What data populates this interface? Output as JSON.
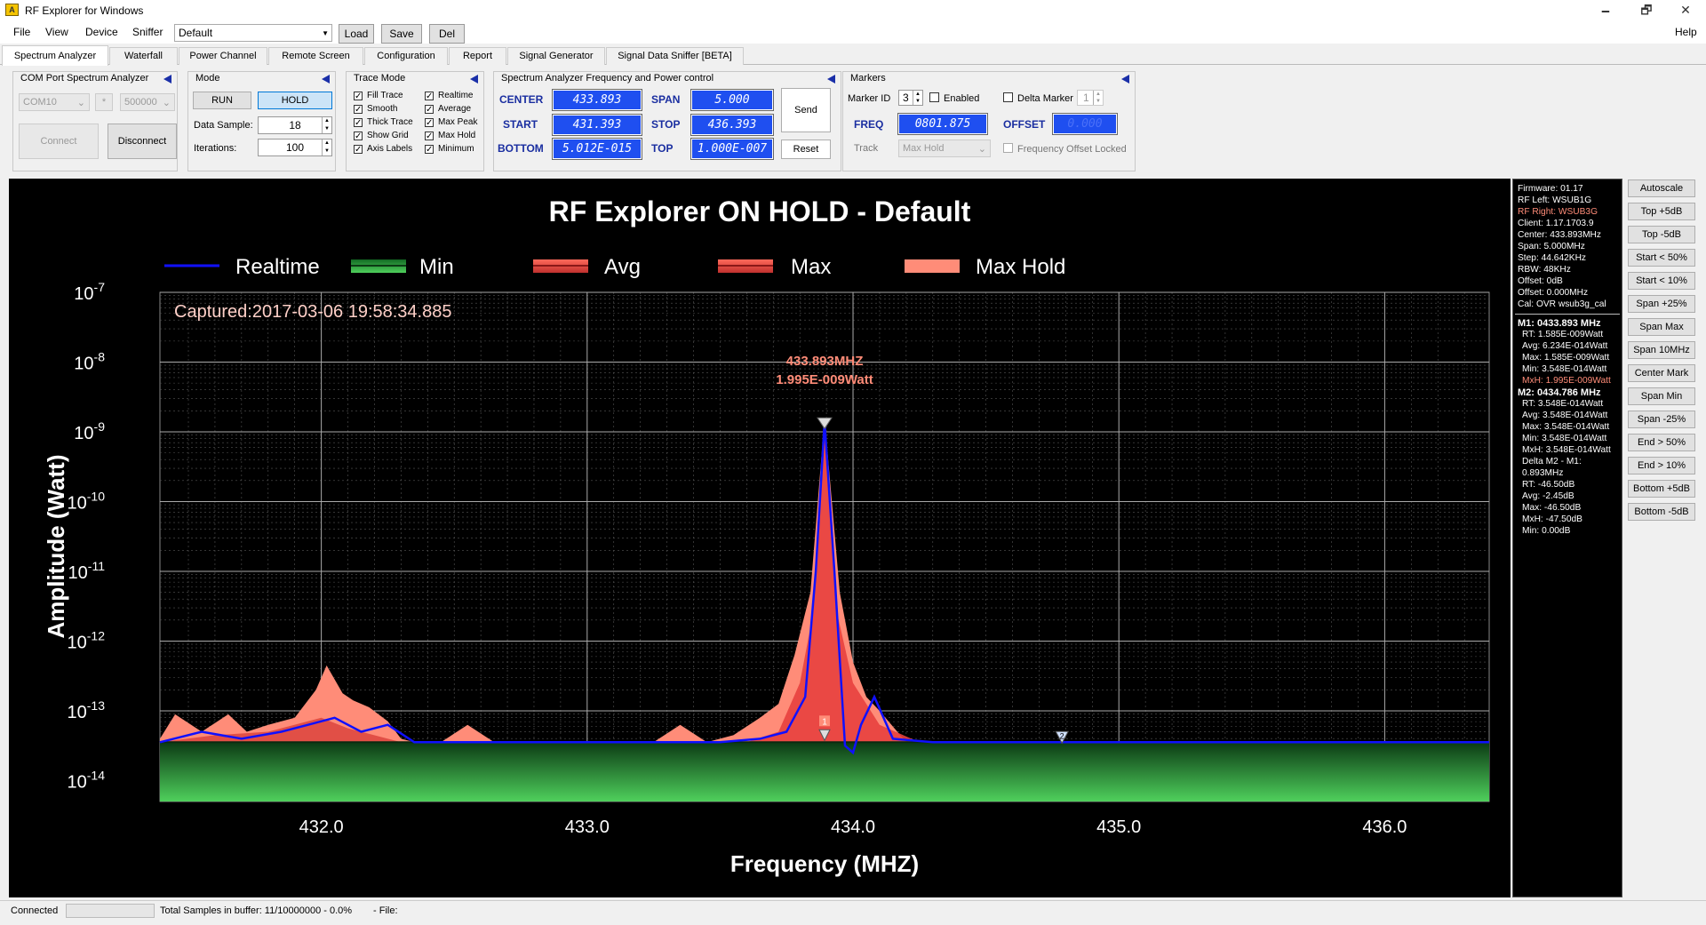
{
  "window": {
    "title": "RF Explorer for Windows",
    "minimize": "🗕",
    "restore": "🗗",
    "close": "✕",
    "logo": "A"
  },
  "menu": {
    "items": [
      "File",
      "View",
      "Device",
      "Sniffer"
    ],
    "help": "Help"
  },
  "toolbar": {
    "profile": "Default",
    "load": "Load",
    "save": "Save",
    "del": "Del"
  },
  "tabs": [
    "Spectrum Analyzer",
    "Waterfall",
    "Power Channel",
    "Remote Screen",
    "Configuration",
    "Report",
    "Signal Generator",
    "Signal Data Sniffer [BETA]"
  ],
  "com": {
    "title": "COM Port Spectrum Analyzer",
    "port": "COM10",
    "star": "*",
    "baud": "500000",
    "connect": "Connect",
    "disconnect": "Disconnect"
  },
  "mode": {
    "title": "Mode",
    "run": "RUN",
    "hold": "HOLD",
    "data_sample_label": "Data Sample:",
    "data_sample": "18",
    "iterations_label": "Iterations:",
    "iterations": "100"
  },
  "trace": {
    "title": "Trace Mode",
    "options": [
      {
        "label": "Fill Trace",
        "checked": true
      },
      {
        "label": "Smooth",
        "checked": true
      },
      {
        "label": "Thick Trace",
        "checked": true
      },
      {
        "label": "Show Grid",
        "checked": true
      },
      {
        "label": "Axis Labels",
        "checked": true
      },
      {
        "label": "Realtime",
        "checked": true
      },
      {
        "label": "Average",
        "checked": true
      },
      {
        "label": "Max Peak",
        "checked": true
      },
      {
        "label": "Max Hold",
        "checked": true
      },
      {
        "label": "Minimum",
        "checked": true
      }
    ]
  },
  "freqctl": {
    "title": "Spectrum Analyzer Frequency and Power control",
    "center_label": "CENTER",
    "center": "433.893",
    "span_label": "SPAN",
    "span": "5.000",
    "start_label": "START",
    "start": "431.393",
    "stop_label": "STOP",
    "stop": "436.393",
    "bottom_label": "BOTTOM",
    "bottom": "5.012E-015",
    "top_label": "TOP",
    "top": "1.000E-007",
    "send": "Send",
    "reset": "Reset"
  },
  "markers": {
    "title": "Markers",
    "id_label": "Marker ID",
    "id": "3",
    "enabled": "Enabled",
    "delta": "Delta Marker",
    "delta_val": "1",
    "freq_label": "FREQ",
    "freq": "0801.875",
    "offset_label": "OFFSET",
    "offset": "0.000",
    "track_label": "Track",
    "track": "Max Hold",
    "offset_locked": "Frequency Offset Locked"
  },
  "chart_data": {
    "type": "line",
    "title": "RF Explorer ON HOLD - Default",
    "xlabel": "Frequency (MHZ)",
    "ylabel": "Amplitude (Watt)",
    "xlim": [
      431.393,
      436.393
    ],
    "ylim_log10": [
      -14.3,
      -7
    ],
    "x_ticks": [
      "432.0",
      "433.0",
      "434.0",
      "435.0",
      "436.0"
    ],
    "y_ticks": [
      {
        "base": "10",
        "exp": "-7"
      },
      {
        "base": "10",
        "exp": "-8"
      },
      {
        "base": "10",
        "exp": "-9"
      },
      {
        "base": "10",
        "exp": "-10"
      },
      {
        "base": "10",
        "exp": "-11"
      },
      {
        "base": "10",
        "exp": "-12"
      },
      {
        "base": "10",
        "exp": "-13"
      },
      {
        "base": "10",
        "exp": "-14"
      }
    ],
    "captured": "Captured:2017-03-06 19:58:34.885",
    "grid": true,
    "legend": [
      {
        "name": "Realtime",
        "color": "#1010ff"
      },
      {
        "name": "Min",
        "color": "#2e9e3e"
      },
      {
        "name": "Avg",
        "color": "#e8403e"
      },
      {
        "name": "Max",
        "color": "#ee4545"
      },
      {
        "name": "Max Hold",
        "color": "#ff8c78"
      }
    ],
    "peak_annotation": {
      "freq": "433.893MHZ",
      "power": "1.995E-009Watt"
    },
    "marker_labels": [
      {
        "id": "1",
        "x": 433.893
      },
      {
        "id": "2",
        "x": 434.786
      }
    ],
    "series": [
      {
        "name": "Max Hold",
        "x": [
          431.393,
          431.45,
          431.55,
          431.65,
          431.72,
          431.8,
          431.9,
          431.98,
          432.02,
          432.08,
          432.12,
          432.18,
          432.25,
          432.3,
          432.35,
          432.45,
          432.55,
          432.65,
          432.75,
          432.85,
          432.95,
          433.05,
          433.15,
          433.25,
          433.35,
          433.45,
          433.55,
          433.65,
          433.72,
          433.78,
          433.84,
          433.893,
          433.95,
          434.0,
          434.05,
          434.1,
          434.2,
          434.3,
          434.4,
          434.5,
          434.6,
          434.7,
          434.8,
          434.9,
          435.0,
          435.5,
          436.0,
          436.393
        ],
        "y_log10": [
          -13.4,
          -13.05,
          -13.3,
          -13.05,
          -13.3,
          -13.2,
          -13.1,
          -12.7,
          -12.35,
          -12.75,
          -12.85,
          -12.95,
          -13.15,
          -13.4,
          -13.45,
          -13.45,
          -13.2,
          -13.45,
          -13.45,
          -13.45,
          -13.45,
          -13.45,
          -13.45,
          -13.45,
          -13.2,
          -13.45,
          -13.35,
          -13.1,
          -12.9,
          -12.2,
          -11.3,
          -8.8,
          -11.3,
          -12.3,
          -12.8,
          -13.0,
          -13.45,
          -13.45,
          -13.45,
          -13.45,
          -13.45,
          -13.45,
          -13.45,
          -13.45,
          -13.45,
          -13.45,
          -13.45,
          -13.45
        ]
      },
      {
        "name": "Realtime",
        "x": [
          431.393,
          431.55,
          431.7,
          431.85,
          431.95,
          432.05,
          432.15,
          432.25,
          432.35,
          432.6,
          433.0,
          433.5,
          433.65,
          433.75,
          433.82,
          433.86,
          433.893,
          433.93,
          433.97,
          434.0,
          434.03,
          434.08,
          434.15,
          434.3,
          434.786,
          435.5,
          436.393
        ],
        "y_log10": [
          -13.45,
          -13.3,
          -13.4,
          -13.3,
          -13.2,
          -13.1,
          -13.3,
          -13.2,
          -13.45,
          -13.45,
          -13.45,
          -13.45,
          -13.4,
          -13.3,
          -12.8,
          -11.0,
          -8.85,
          -11.0,
          -13.5,
          -13.6,
          -13.2,
          -12.8,
          -13.4,
          -13.45,
          -13.45,
          -13.45,
          -13.45
        ]
      },
      {
        "name": "Min",
        "x": [
          431.393,
          436.393
        ],
        "y_log10": [
          -13.45,
          -13.45
        ]
      }
    ]
  },
  "info": {
    "lines": [
      {
        "t": "Firmware: 01.17",
        "c": "#fff"
      },
      {
        "t": "RF Left: WSUB1G",
        "c": "#fff"
      },
      {
        "t": "RF Right: WSUB3G",
        "c": "#ff8c78"
      },
      {
        "t": "Client: 1.17.1703.9",
        "c": "#fff"
      },
      {
        "t": "Center: 433.893MHz",
        "c": "#fff"
      },
      {
        "t": "Span: 5.000MHz",
        "c": "#fff"
      },
      {
        "t": "Step: 44.642KHz",
        "c": "#fff"
      },
      {
        "t": "RBW: 48KHz",
        "c": "#fff"
      },
      {
        "t": "Offset: 0dB",
        "c": "#fff"
      },
      {
        "t": "Offset: 0.000MHz",
        "c": "#fff"
      },
      {
        "t": "Cal: OVR wsub3g_cal",
        "c": "#fff"
      }
    ],
    "marker_lines": [
      {
        "t": "M1: 0433.893 MHz",
        "c": "#fff",
        "b": true
      },
      {
        "t": "RT: 1.585E-009Watt",
        "c": "#fff"
      },
      {
        "t": "Avg: 6.234E-014Watt",
        "c": "#fff"
      },
      {
        "t": "Max: 1.585E-009Watt",
        "c": "#fff"
      },
      {
        "t": "Min: 3.548E-014Watt",
        "c": "#fff"
      },
      {
        "t": "MxH: 1.995E-009Watt",
        "c": "#ff8c78"
      },
      {
        "t": "M2: 0434.786 MHz",
        "c": "#fff",
        "b": true
      },
      {
        "t": "RT: 3.548E-014Watt",
        "c": "#fff"
      },
      {
        "t": "Avg: 3.548E-014Watt",
        "c": "#fff"
      },
      {
        "t": "Max: 3.548E-014Watt",
        "c": "#fff"
      },
      {
        "t": "Min: 3.548E-014Watt",
        "c": "#fff"
      },
      {
        "t": "MxH: 3.548E-014Watt",
        "c": "#fff"
      },
      {
        "t": "Delta M2 - M1:",
        "c": "#fff"
      },
      {
        "t": "  0.893MHz",
        "c": "#fff"
      },
      {
        "t": "  RT: -46.50dB",
        "c": "#fff"
      },
      {
        "t": "  Avg: -2.45dB",
        "c": "#fff"
      },
      {
        "t": "  Max: -46.50dB",
        "c": "#fff"
      },
      {
        "t": "  MxH: -47.50dB",
        "c": "#fff"
      },
      {
        "t": "  Min: 0.00dB",
        "c": "#fff"
      }
    ]
  },
  "right_buttons": [
    "Autoscale",
    "Top +5dB",
    "Top -5dB",
    "Start < 50%",
    "Start < 10%",
    "Span +25%",
    "Span Max",
    "Span 10MHz",
    "Center Mark",
    "Span Min",
    "Span -25%",
    "End > 50%",
    "End > 10%",
    "Bottom +5dB",
    "Bottom -5dB"
  ],
  "status": {
    "state": "Connected",
    "samples": "Total Samples in buffer: 11/10000000 - 0.0%",
    "file": "- File:"
  }
}
